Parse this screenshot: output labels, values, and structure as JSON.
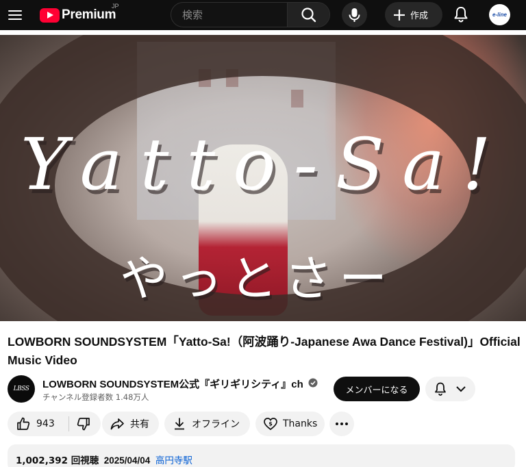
{
  "header": {
    "logo_text": "Premium",
    "region": "JP",
    "search_placeholder": "検索",
    "create_label": "作成",
    "account_label": "e-line"
  },
  "video": {
    "thumbnail_title": "Yatto-Sa!",
    "thumbnail_kana": "やっとさー",
    "title": "LOWBORN SOUNDSYSTEM「Yatto-Sa!（阿波踊り-Japanese Awa Dance Festival)」Official Music Video",
    "views": "1,002,392 回視聴",
    "date": "2025/04/04",
    "location": "高円寺駅"
  },
  "channel": {
    "avatar_text": "LBSS",
    "name": "LOWBORN SOUNDSYSTEM公式『ギリギリシティ』ch",
    "subscribers": "チャンネル登録者数 1.48万人",
    "member_button": "メンバーになる"
  },
  "actions": {
    "likes": "943",
    "share": "共有",
    "offline": "オフライン",
    "thanks": "Thanks"
  },
  "colors": {
    "brand_red": "#ff0033",
    "link_blue": "#065fd4",
    "topbar_bg": "#0f0f0f"
  }
}
